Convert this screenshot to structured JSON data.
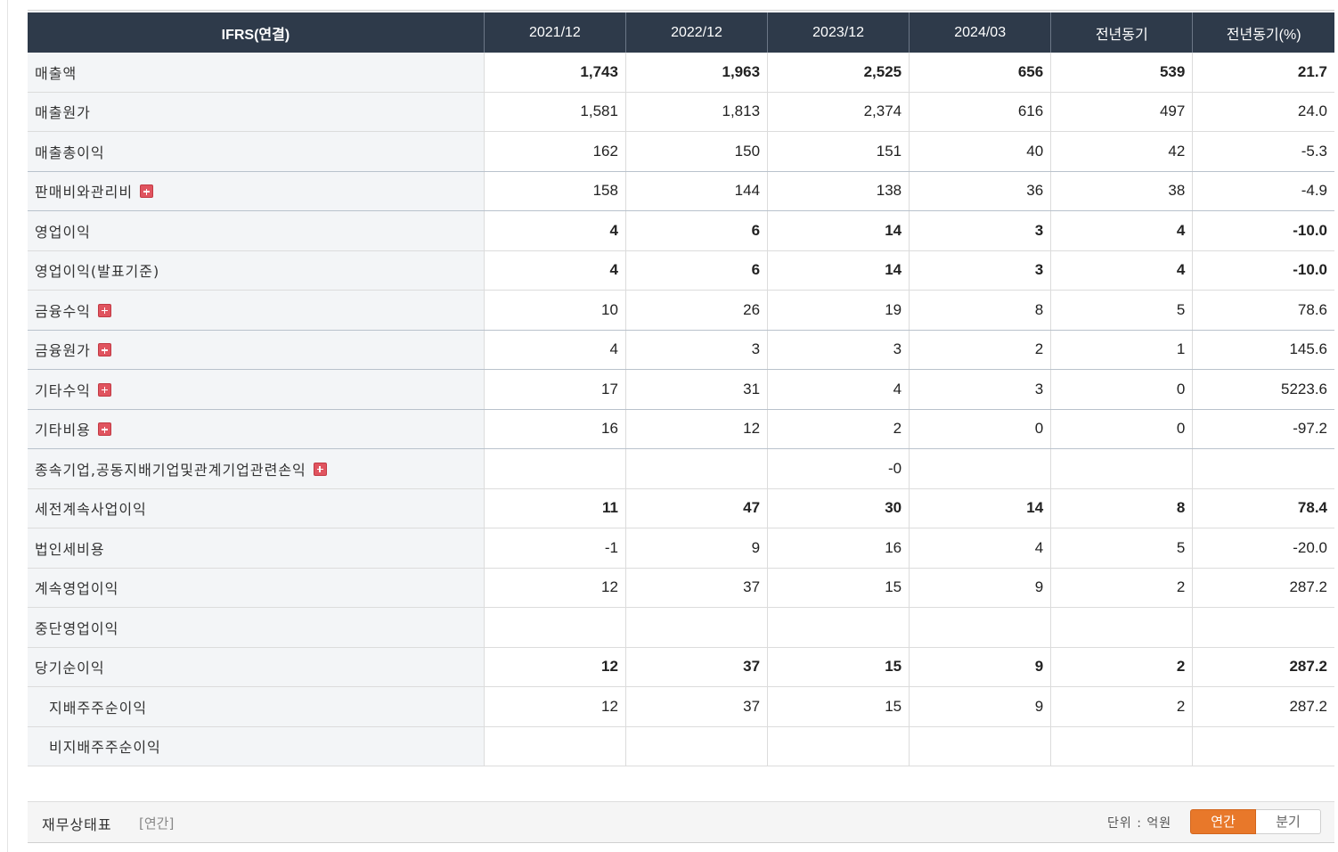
{
  "table": {
    "headers": [
      "IFRS(연결)",
      "2021/12",
      "2022/12",
      "2023/12",
      "2024/03",
      "전년동기",
      "전년동기(%)"
    ],
    "rows": [
      {
        "label": "매출액",
        "values": [
          "1,743",
          "1,963",
          "2,525",
          "656",
          "539",
          "21.7"
        ]
      },
      {
        "label": "매출원가",
        "values": [
          "1,581",
          "1,813",
          "2,374",
          "616",
          "497",
          "24.0"
        ]
      },
      {
        "label": "매출총이익",
        "values": [
          "162",
          "150",
          "151",
          "40",
          "42",
          "-5.3"
        ]
      },
      {
        "label": "판매비와관리비",
        "values": [
          "158",
          "144",
          "138",
          "36",
          "38",
          "-4.9"
        ]
      },
      {
        "label": "영업이익",
        "values": [
          "4",
          "6",
          "14",
          "3",
          "4",
          "-10.0"
        ]
      },
      {
        "label": "영업이익(발표기준)",
        "values": [
          "4",
          "6",
          "14",
          "3",
          "4",
          "-10.0"
        ]
      },
      {
        "label": "금융수익",
        "values": [
          "10",
          "26",
          "19",
          "8",
          "5",
          "78.6"
        ]
      },
      {
        "label": "금융원가",
        "values": [
          "4",
          "3",
          "3",
          "2",
          "1",
          "145.6"
        ]
      },
      {
        "label": "기타수익",
        "values": [
          "17",
          "31",
          "4",
          "3",
          "0",
          "5223.6"
        ]
      },
      {
        "label": "기타비용",
        "values": [
          "16",
          "12",
          "2",
          "0",
          "0",
          "-97.2"
        ]
      },
      {
        "label": "종속기업,공동지배기업및관계기업관련손익",
        "values": [
          "",
          "",
          "-0",
          "",
          "",
          ""
        ]
      },
      {
        "label": "세전계속사업이익",
        "values": [
          "11",
          "47",
          "30",
          "14",
          "8",
          "78.4"
        ]
      },
      {
        "label": "법인세비용",
        "values": [
          "-1",
          "9",
          "16",
          "4",
          "5",
          "-20.0"
        ]
      },
      {
        "label": "계속영업이익",
        "values": [
          "12",
          "37",
          "15",
          "9",
          "2",
          "287.2"
        ]
      },
      {
        "label": "중단영업이익",
        "values": [
          "",
          "",
          "",
          "",
          "",
          ""
        ]
      },
      {
        "label": "당기순이익",
        "values": [
          "12",
          "37",
          "15",
          "9",
          "2",
          "287.2"
        ]
      },
      {
        "label": "지배주주순이익",
        "values": [
          "12",
          "37",
          "15",
          "9",
          "2",
          "287.2"
        ]
      },
      {
        "label": "비지배주주순이익",
        "values": [
          "",
          "",
          "",
          "",
          "",
          ""
        ]
      }
    ]
  },
  "next_section": {
    "title": "재무상태표",
    "subtitle": "[연간]",
    "unit": "단위 : 억원",
    "toggle": {
      "annual": "연간",
      "quarterly": "분기",
      "selected": "annual"
    }
  },
  "colors": {
    "header_bg": "#2e3a4a",
    "negative": "#e0262d",
    "accent": "#e8782a",
    "expand_icon": "#e0545f"
  }
}
